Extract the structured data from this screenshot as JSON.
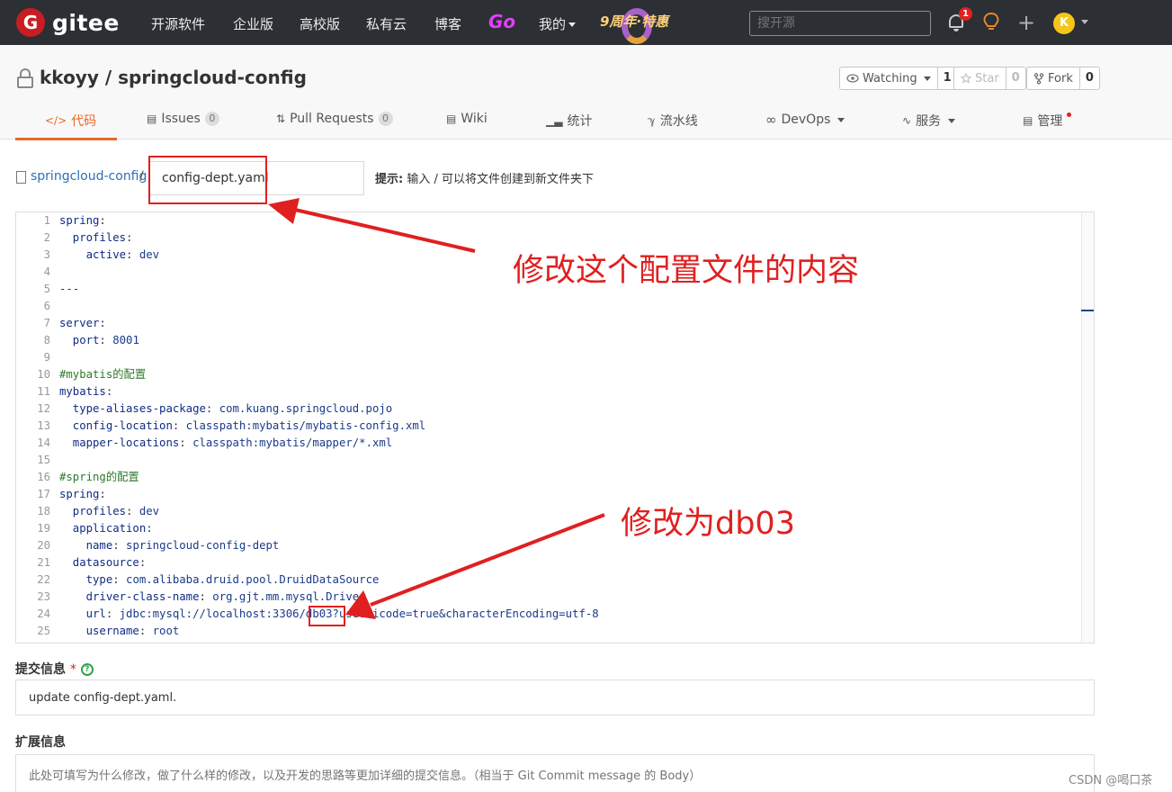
{
  "navbar": {
    "logo_mark": "G",
    "logo_text": "gitee",
    "links": [
      "开源软件",
      "企业版",
      "高校版",
      "私有云",
      "博客"
    ],
    "go_label": "Go",
    "mine_label": "我的",
    "promo_text": "9周年·特惠",
    "search_placeholder": "搜开源",
    "notification_count": "1",
    "user_initial": "K"
  },
  "repo": {
    "title": "kkoyy / springcloud-config",
    "watching_label": "Watching",
    "watching_count": "1",
    "star_label": "Star",
    "star_count": "0",
    "fork_label": "Fork",
    "fork_count": "0"
  },
  "tabs": {
    "code": "代码",
    "issues": "Issues",
    "issues_count": "0",
    "pull_requests": "Pull Requests",
    "pull_requests_count": "0",
    "wiki": "Wiki",
    "stats": "统计",
    "pipeline": "流水线",
    "devops": "DevOps",
    "services": "服务",
    "manage": "管理"
  },
  "file_path": {
    "breadcrumb": "springcloud-config",
    "separator": "/",
    "filename": "config-dept.yaml",
    "hint_label": "提示:",
    "hint_text": "输入 / 可以将文件创建到新文件夹下"
  },
  "editor": {
    "lines": [
      [
        {
          "t": "spring",
          "c": "k"
        },
        {
          "t": ":",
          "c": "p"
        }
      ],
      [
        {
          "t": "  profiles",
          "c": "k"
        },
        {
          "t": ":",
          "c": "p"
        }
      ],
      [
        {
          "t": "    active",
          "c": "k"
        },
        {
          "t": ": ",
          "c": "p"
        },
        {
          "t": "dev",
          "c": "v"
        }
      ],
      [],
      [
        {
          "t": "---",
          "c": "p"
        }
      ],
      [],
      [
        {
          "t": "server",
          "c": "k"
        },
        {
          "t": ":",
          "c": "p"
        }
      ],
      [
        {
          "t": "  port",
          "c": "k"
        },
        {
          "t": ": ",
          "c": "p"
        },
        {
          "t": "8001",
          "c": "v"
        }
      ],
      [],
      [
        {
          "t": "#mybatis的配置",
          "c": "c"
        }
      ],
      [
        {
          "t": "mybatis",
          "c": "k"
        },
        {
          "t": ":",
          "c": "p"
        }
      ],
      [
        {
          "t": "  type-aliases-package",
          "c": "k"
        },
        {
          "t": ": ",
          "c": "p"
        },
        {
          "t": "com.kuang.springcloud.pojo",
          "c": "v"
        }
      ],
      [
        {
          "t": "  config-location",
          "c": "k"
        },
        {
          "t": ": ",
          "c": "p"
        },
        {
          "t": "classpath:mybatis/mybatis-config.xml",
          "c": "v"
        }
      ],
      [
        {
          "t": "  mapper-locations",
          "c": "k"
        },
        {
          "t": ": ",
          "c": "p"
        },
        {
          "t": "classpath:mybatis/mapper/*.xml",
          "c": "v"
        }
      ],
      [],
      [
        {
          "t": "#spring的配置",
          "c": "c"
        }
      ],
      [
        {
          "t": "spring",
          "c": "k"
        },
        {
          "t": ":",
          "c": "p"
        }
      ],
      [
        {
          "t": "  profiles",
          "c": "k"
        },
        {
          "t": ": ",
          "c": "p"
        },
        {
          "t": "dev",
          "c": "v"
        }
      ],
      [
        {
          "t": "  application",
          "c": "k"
        },
        {
          "t": ":",
          "c": "p"
        }
      ],
      [
        {
          "t": "    name",
          "c": "k"
        },
        {
          "t": ": ",
          "c": "p"
        },
        {
          "t": "springcloud-config-dept",
          "c": "v"
        }
      ],
      [
        {
          "t": "  datasource",
          "c": "k"
        },
        {
          "t": ":",
          "c": "p"
        }
      ],
      [
        {
          "t": "    type",
          "c": "k"
        },
        {
          "t": ": ",
          "c": "p"
        },
        {
          "t": "com.alibaba.druid.pool.DruidDataSource",
          "c": "v"
        }
      ],
      [
        {
          "t": "    driver-class-name",
          "c": "k"
        },
        {
          "t": ": ",
          "c": "p"
        },
        {
          "t": "org.gjt.mm.mysql.Driver",
          "c": "v"
        }
      ],
      [
        {
          "t": "    url",
          "c": "k"
        },
        {
          "t": ": ",
          "c": "p"
        },
        {
          "t": "jdbc:mysql://localhost:3306/db03?useUnicode=true&characterEncoding=utf-8",
          "c": "v"
        }
      ],
      [
        {
          "t": "    username",
          "c": "k"
        },
        {
          "t": ": ",
          "c": "p"
        },
        {
          "t": "root",
          "c": "v"
        }
      ]
    ]
  },
  "commit": {
    "label": "提交信息",
    "required_mark": "*",
    "help_glyph": "?",
    "value": "update config-dept.yaml."
  },
  "extension": {
    "label": "扩展信息",
    "placeholder": "此处可填写为什么修改，做了什么样的修改，以及开发的思路等更加详细的提交信息。（相当于 Git Commit message 的 Body）"
  },
  "annotations": {
    "top_note": "修改这个配置文件的内容",
    "bottom_note": "修改为db03",
    "color": "#e02020"
  },
  "watermark": "CSDN @喝口茶",
  "colors": {
    "navbar_bg": "#2c2f33",
    "brand_red": "#c71d23",
    "active_tab": "#e8692a",
    "link_blue": "#2c6fb5"
  },
  "icons": [
    "lock-icon",
    "eye-icon",
    "star-icon",
    "fork-icon",
    "bell-icon",
    "bulb-icon",
    "plus-icon",
    "file-icon",
    "help-icon"
  ]
}
